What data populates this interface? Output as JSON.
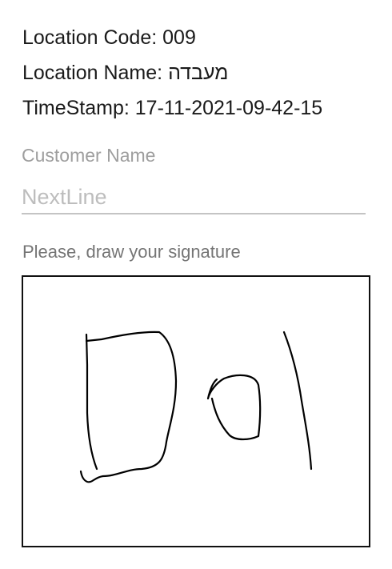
{
  "location": {
    "code_label": "Location Code:",
    "code_value": "009",
    "name_label": "Location Name:",
    "name_value": "מעבדה",
    "timestamp_label": "TimeStamp:",
    "timestamp_value": "17-11-2021-09-42-15"
  },
  "customer": {
    "label": "Customer Name",
    "placeholder": "NextLine",
    "value": ""
  },
  "signature": {
    "instruction": "Please, draw your signature",
    "stroke_color": "#000000"
  }
}
